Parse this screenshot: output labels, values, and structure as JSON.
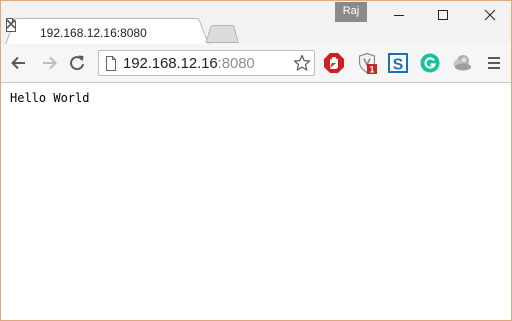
{
  "profile": {
    "name": "Raj"
  },
  "tab": {
    "title": "192.168.12.16:8080"
  },
  "address_bar": {
    "host": "192.168.12.16",
    "port": ":8080"
  },
  "extensions": {
    "shield_badge": "1",
    "s_letter": "S"
  },
  "page": {
    "body_text": "Hello World"
  },
  "colors": {
    "window_border": "#e3a878",
    "stop_red": "#d01f1f",
    "s_blue": "#1c6fb5",
    "grammarly_green": "#15c39a",
    "badge_red": "#c62828"
  },
  "icons": [
    "page-icon",
    "close-icon",
    "minimize-icon",
    "maximize-icon",
    "back-arrow-icon",
    "forward-arrow-icon",
    "reload-icon",
    "star-icon",
    "stop-sign-icon",
    "shield-icon",
    "s-logo-icon",
    "grammarly-icon",
    "cloud-icon",
    "menu-icon"
  ]
}
